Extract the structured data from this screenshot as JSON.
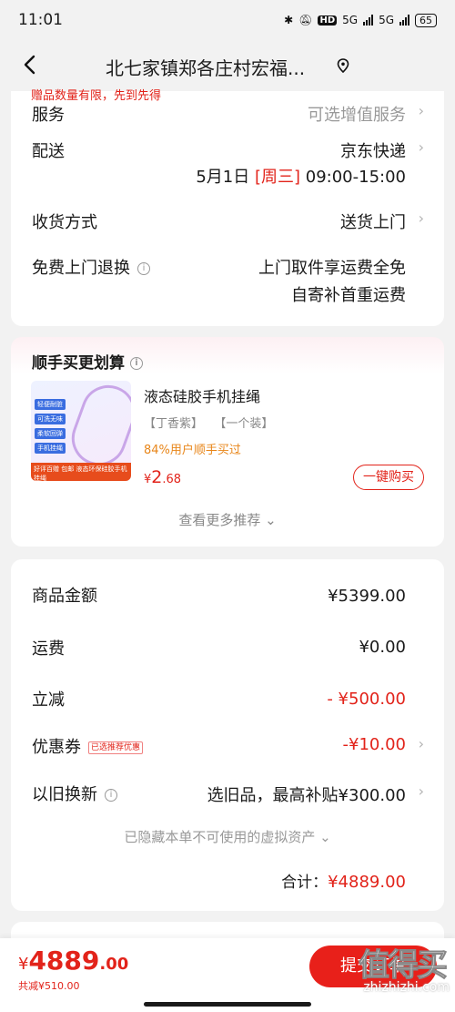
{
  "status": {
    "time": "11:01",
    "net1": "5G",
    "net2": "5G",
    "hd": "HD",
    "battery": "65"
  },
  "nav": {
    "title": "北七家镇郑各庄村宏福..."
  },
  "order": {
    "promo_cut": "赠品数量有限，先到先得",
    "service_label": "服务",
    "service_value": "可选增值服务",
    "delivery_label": "配送",
    "delivery_value": "京东快递",
    "delivery_date": "5月1日",
    "delivery_weekday": "[周三]",
    "delivery_time": "09:00-15:00",
    "receive_label": "收货方式",
    "receive_value": "送货上门",
    "return_label": "免费上门退换",
    "return_line1": "上门取件享运费全免",
    "return_line2": "自寄补首重运费"
  },
  "cross_sell": {
    "title": "顺手买更划算",
    "product_name": "液态硅胶手机挂绳",
    "spec_color": "【丁香紫】",
    "spec_pack": "【一个装】",
    "note": "84%用户顺手买过",
    "currency": "¥",
    "price_int": "2",
    "price_dec": ".68",
    "buy_label": "一键购买",
    "more_label": "查看更多推荐",
    "thumb_tags": [
      "轻便耐脏",
      "可洗无味",
      "柔软回弹",
      "手机挂绳"
    ],
    "thumb_strip": "好评百赠 包邮 液态环保硅胶手机挂绳"
  },
  "summary": {
    "goods_label": "商品金额",
    "goods_value": "¥5399.00",
    "freight_label": "运费",
    "freight_value": "¥0.00",
    "discount_label": "立减",
    "discount_value": "- ¥500.00",
    "coupon_label": "优惠券",
    "coupon_badge": "已选推荐优惠",
    "coupon_value": "-¥10.00",
    "tradein_label": "以旧换新",
    "tradein_value": "选旧品，最高补贴¥300.00",
    "hidden_note": "已隐藏本单不可使用的虚拟资产",
    "total_label": "合计：",
    "total_value": "¥4889.00"
  },
  "bottom": {
    "currency": "¥",
    "price_int": "4889",
    "price_dec": ".00",
    "saved": "共减¥510.00",
    "submit_label": "提交订单",
    "watermark_logo": "值得买",
    "watermark_url": "zhizhizhi.com"
  },
  "colors": {
    "accent": "#e2231a",
    "note": "#e8861a",
    "background": "#f2f2f2"
  }
}
